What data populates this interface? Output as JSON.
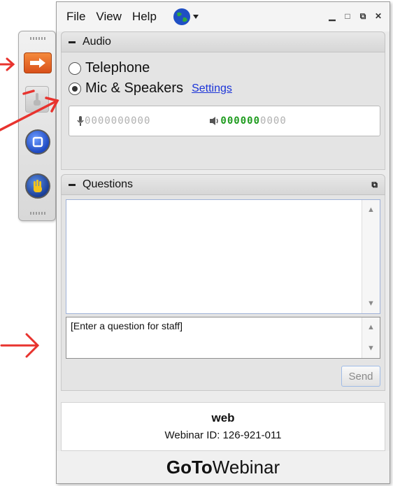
{
  "menu": {
    "file": "File",
    "view": "View",
    "help": "Help",
    "globe_icon": "globe-icon",
    "window_controls": [
      "minimize-icon",
      "maximize-icon",
      "restore-icon",
      "close-icon"
    ]
  },
  "audio": {
    "header": "Audio",
    "telephone_label": "Telephone",
    "mic_label": "Mic & Speakers",
    "settings_link": "Settings",
    "selected": "mic",
    "mic_meter_level": 0,
    "speaker_meter_level": 6,
    "meter_segments": 10
  },
  "questions": {
    "header": "Questions",
    "input_placeholder": "[Enter a question for staff]",
    "send_label": "Send"
  },
  "footer": {
    "organizer": "web",
    "webinar_id": "Webinar ID: 126-921-011",
    "brand_bold": "GoTo",
    "brand_rest": "Webinar"
  },
  "colors": {
    "accent_orange": "#e8662a",
    "annotation_red": "#e8332e",
    "meter_green": "#1f9c1f",
    "link_blue": "#1a33d8"
  }
}
